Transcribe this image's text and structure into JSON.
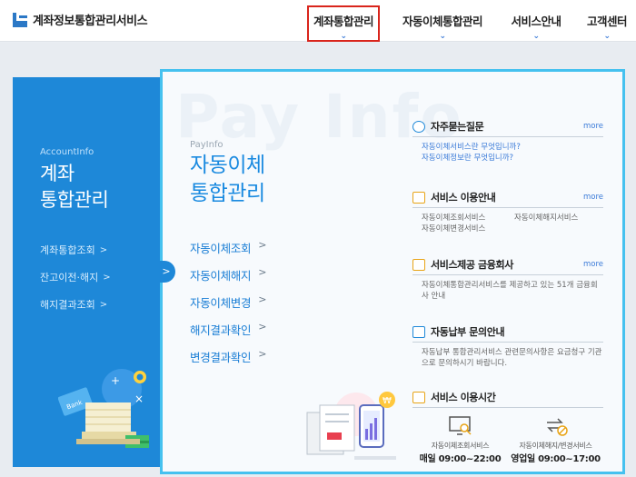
{
  "header": {
    "logo_text": "계좌정보통합관리서비스",
    "nav": [
      {
        "label": "계좌통합관리"
      },
      {
        "label": "자동이체통합관리"
      },
      {
        "label": "서비스안내"
      },
      {
        "label": "고객센터"
      }
    ]
  },
  "account": {
    "subtitle": "AccountInfo",
    "title_line1": "계좌",
    "title_line2": "통합관리",
    "menu": [
      "계좌통합조회",
      "잔고이전·해지",
      "해지결과조회"
    ]
  },
  "pay": {
    "watermark": "Pay Info",
    "subtitle": "PayInfo",
    "title_line1": "자동이체",
    "title_line2": "통합관리",
    "menu": [
      "자동이체조회",
      "자동이체해지",
      "자동이체변경",
      "해지결과확인",
      "변경결과확인"
    ]
  },
  "info": {
    "faq": {
      "title": "자주묻는질문",
      "more": "more",
      "items": [
        "자동이체서비스란 무엇입니까?",
        "자동이체정보란 무엇입니까?"
      ]
    },
    "guide": {
      "title": "서비스 이용안내",
      "more": "more",
      "items": [
        "자동이체조회서비스",
        "자동이체해지서비스",
        "자동이체변경서비스"
      ]
    },
    "banks": {
      "title": "서비스제공 금융회사",
      "more": "more",
      "text": "자동이체통합관리서비스를 제공하고 있는 51개 금융회사 안내"
    },
    "inquiry": {
      "title": "자동납부 문의안내",
      "text": "자동납부 통합관리서비스 관련문의사항은 요금청구 기관으로 문의하시기 바랍니다."
    },
    "hours": {
      "title": "서비스 이용시간",
      "items": [
        {
          "label": "자동이체조회서비스",
          "time": "매일 09:00~22:00"
        },
        {
          "label": "자동이체해지/변경서비스",
          "time": "영업일 09:00~17:00"
        }
      ]
    }
  },
  "icons": {
    "chevron": "chevron-down-icon",
    "colors": {
      "primary": "#1e88d8",
      "accent": "#45c1ef",
      "highlight": "#d9251c"
    }
  }
}
